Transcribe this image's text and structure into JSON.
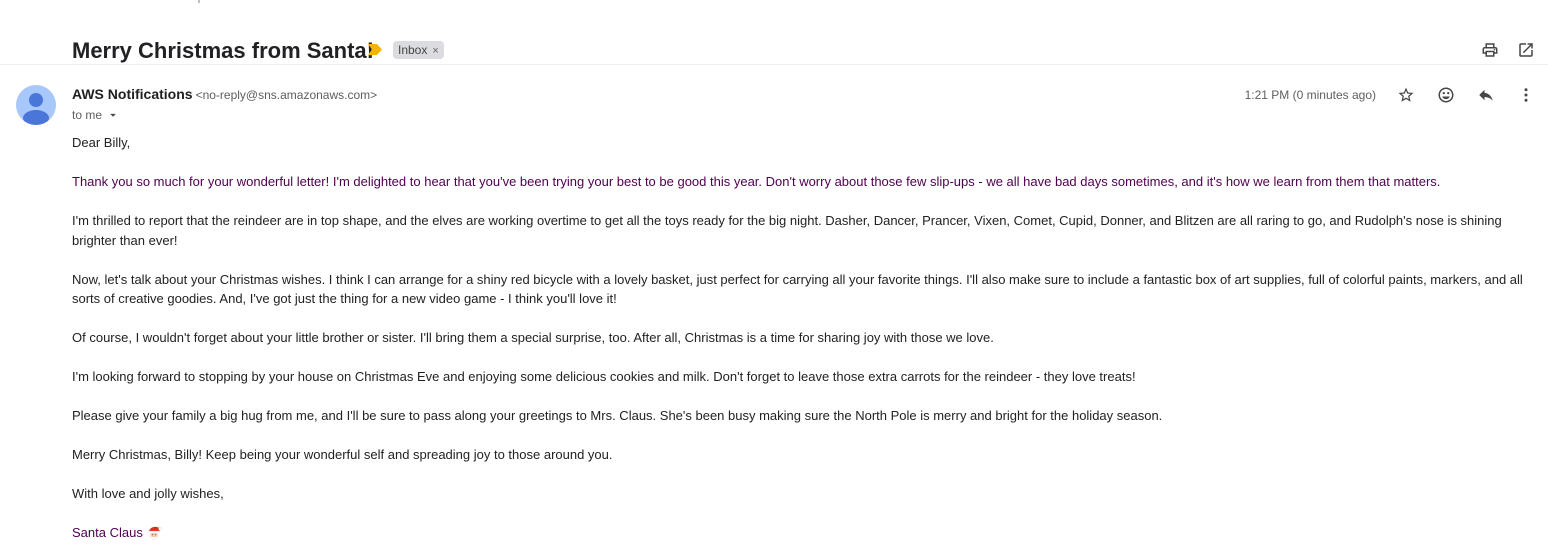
{
  "email": {
    "subject": "Merry Christmas from Santa!",
    "label": "Inbox",
    "label_remove": "×",
    "sender_name": "AWS Notifications",
    "sender_email": "<no-reply@sns.amazonaws.com>",
    "recipient": "to me",
    "time": "1:21 PM (0 minutes ago)"
  },
  "icons": {
    "importance": "importance-marker-icon",
    "print": "print-icon",
    "open_new_window": "open-in-new-window-icon",
    "star": "star-icon",
    "emoji": "emoji-reaction-icon",
    "reply": "reply-icon",
    "more": "more-vertical-icon",
    "dropdown": "chevron-down-icon",
    "avatar": "person-icon",
    "santa": "santa-emoji-icon"
  },
  "colors": {
    "importance": "#f4b400",
    "quoted_text": "#500050",
    "avatar_bg": "#a8c7fa",
    "avatar_fg": "#4a76d9"
  },
  "body": {
    "greeting": "Dear Billy,",
    "p1": "Thank you so much for your wonderful letter! I'm delighted to hear that you've been trying your best to be good this year. Don't worry about those few slip-ups - we all have bad days sometimes, and it's how we learn from them that matters.",
    "p2": "I'm thrilled to report that the reindeer are in top shape, and the elves are working overtime to get all the toys ready for the big night. Dasher, Dancer, Prancer, Vixen, Comet, Cupid, Donner, and Blitzen are all raring to go, and Rudolph's nose is shining brighter than ever!",
    "p3": "Now, let's talk about your Christmas wishes. I think I can arrange for a shiny red bicycle with a lovely basket, just perfect for carrying all your favorite things. I'll also make sure to include a fantastic box of art supplies, full of colorful paints, markers, and all sorts of creative goodies. And, I've got just the thing for a new video game - I think you'll love it!",
    "p4": "Of course, I wouldn't forget about your little brother or sister. I'll bring them a special surprise, too. After all, Christmas is a time for sharing joy with those we love.",
    "p5": "I'm looking forward to stopping by your house on Christmas Eve and enjoying some delicious cookies and milk. Don't forget to leave those extra carrots for the reindeer - they love treats!",
    "p6": "Please give your family a big hug from me, and I'll be sure to pass along your greetings to Mrs. Claus. She's been busy making sure the North Pole is merry and bright for the holiday season.",
    "p7": "Merry Christmas, Billy! Keep being your wonderful self and spreading joy to those around you.",
    "closing": "With love and jolly wishes,",
    "signature": "Santa Claus"
  }
}
